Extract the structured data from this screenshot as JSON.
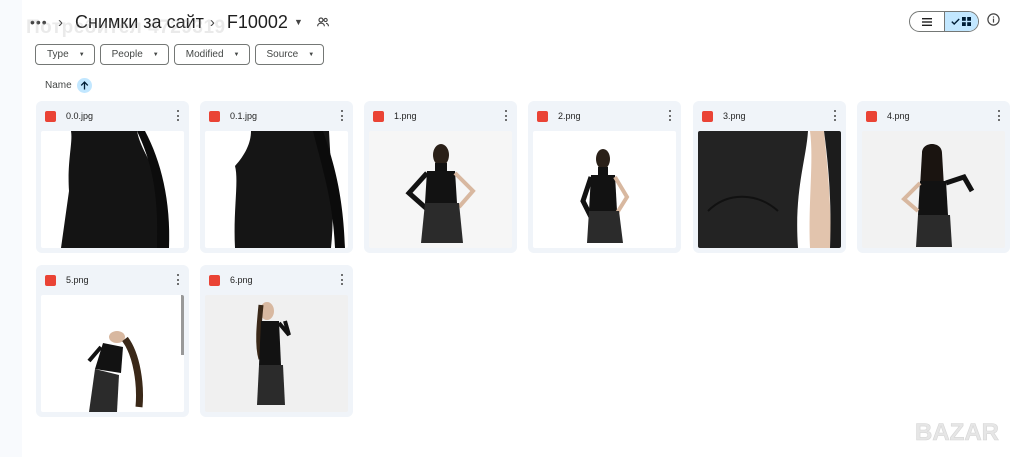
{
  "breadcrumb": {
    "more": "•••",
    "parent": "Снимки за сайт",
    "current": "F10002"
  },
  "watermark": "Потребител 4729319",
  "filters": [
    {
      "label": "Type"
    },
    {
      "label": "People"
    },
    {
      "label": "Modified"
    },
    {
      "label": "Source"
    }
  ],
  "sort": {
    "label": "Name",
    "direction": "ascending"
  },
  "files": [
    {
      "name": "0.0.jpg"
    },
    {
      "name": "0.1.jpg"
    },
    {
      "name": "1.png"
    },
    {
      "name": "2.png"
    },
    {
      "name": "3.png"
    },
    {
      "name": "4.png"
    },
    {
      "name": "5.png"
    },
    {
      "name": "6.png"
    }
  ],
  "icons": {
    "more": "more-horiz-icon",
    "people": "people-icon",
    "list_view": "list-view-icon",
    "grid_view": "grid-view-icon",
    "check": "check-icon",
    "info": "info-icon",
    "image_file": "image-file-icon",
    "sort_arrow": "arrow-up-icon",
    "kebab": "more-vert-icon"
  },
  "colors": {
    "accent": "#c2e7ff",
    "card_bg": "#f0f4f9",
    "image_icon": "#ea4335"
  },
  "corner_logo": "BAZAR"
}
